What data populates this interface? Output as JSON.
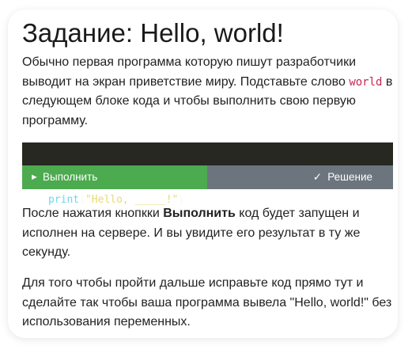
{
  "task": {
    "title": "Задание: Hello, world!",
    "intro_before": "Обычно первая программа которую пишут разработчики выводит на экран приветствие миру. Подставьте слово ",
    "intro_code": "world",
    "intro_after": " в следующем блоке кода и чтобы выполнить свою первую программу."
  },
  "code": {
    "line_number": "1",
    "func": "print",
    "open_paren": "(",
    "string": "\"Hello, _____!\"",
    "close_paren": ")"
  },
  "buttons": {
    "run_icon": "play-icon",
    "run_glyph": "►",
    "run_label": "Выполнить",
    "solution_icon": "checkmark-icon",
    "solution_glyph": "✓",
    "solution_label": "Решение",
    "run_color": "#4caa4f",
    "solution_color": "#6c757d"
  },
  "after_run": {
    "before_bold": "После нажатия кнопкки ",
    "bold": "Выполнить",
    "after_bold": " код будет запущен и исполнен на сервере. И вы увидите его результат в ту же секунду."
  },
  "instruction": {
    "text": "Для того чтобы пройти дальше исправьте код прямо тут и сделайте так чтобы ваша программа вывела \"Hello, world!\" без использования переменных."
  }
}
